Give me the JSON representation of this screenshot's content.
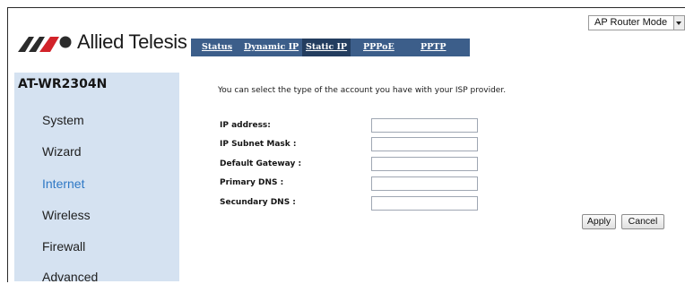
{
  "mode_select": {
    "value": "AP Router Mode"
  },
  "brand": {
    "name": "Allied Telesis"
  },
  "tabs": [
    {
      "label": "Status"
    },
    {
      "label": "Dynamic IP"
    },
    {
      "label": "Static IP",
      "active": true
    },
    {
      "label": "PPPoE"
    },
    {
      "label": "PPTP"
    }
  ],
  "sidebar": {
    "model": "AT-WR2304N",
    "items": [
      {
        "label": "System"
      },
      {
        "label": "Wizard"
      },
      {
        "label": "Internet",
        "active": true
      },
      {
        "label": "Wireless"
      },
      {
        "label": "Firewall"
      },
      {
        "label": "Advanced"
      }
    ]
  },
  "main": {
    "intro": "You can select the type of the account you have with your ISP provider.",
    "fields": [
      {
        "label": "IP address:",
        "value": ""
      },
      {
        "label": "IP Subnet Mask :",
        "value": ""
      },
      {
        "label": "Default Gateway :",
        "value": ""
      },
      {
        "label": "Primary DNS :",
        "value": ""
      },
      {
        "label": "Secundary DNS :",
        "value": ""
      }
    ],
    "apply_label": "Apply",
    "cancel_label": "Cancel"
  },
  "colors": {
    "tab_bar": "#3c5e8a",
    "tab_active": "#233d5f",
    "sidebar_bg": "#d5e2f1",
    "nav_active": "#2e78c5",
    "logo_red": "#d2232a",
    "logo_dark": "#2b2b2b"
  }
}
